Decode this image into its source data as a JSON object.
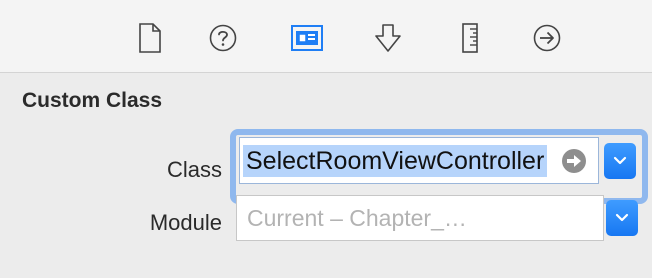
{
  "toolbar": {
    "icons": [
      "file-icon",
      "help-icon",
      "identity-icon",
      "attributes-icon",
      "size-icon",
      "connections-icon"
    ],
    "selected": "identity-icon",
    "accent": "#1f7ef5"
  },
  "custom_class": {
    "title": "Custom Class",
    "class_label": "Class",
    "class_value": "SelectRoomViewController",
    "module_label": "Module",
    "module_placeholder": "Current – Chapter_…"
  }
}
